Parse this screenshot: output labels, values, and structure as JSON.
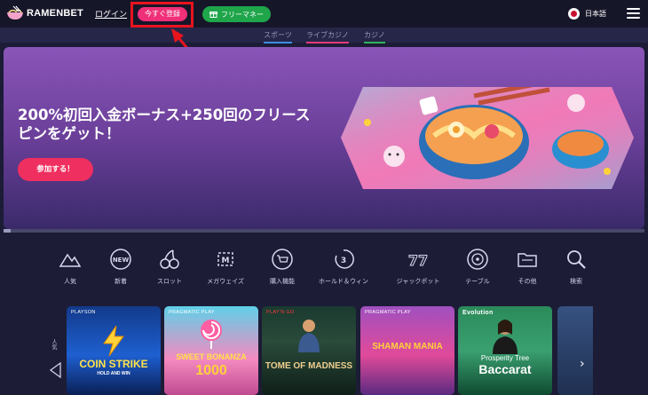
{
  "header": {
    "brand": "RAMENBET",
    "login_label": "ログイン",
    "register_label": "今すぐ登録",
    "freemoney_label": "フリーマネー",
    "language_label": "日本語"
  },
  "subnav": {
    "items": [
      {
        "label": "スポーツ",
        "color": "#3a8ee6"
      },
      {
        "label": "ライブカジノ",
        "color": "#e63a7a"
      },
      {
        "label": "カジノ",
        "color": "#2fb35a"
      }
    ]
  },
  "banner": {
    "title": "200%初回入金ボーナス+250回のフリースピンをゲット！",
    "cta_label": "参加する！"
  },
  "categories": [
    {
      "label": "人気",
      "icon": "mountain-icon"
    },
    {
      "label": "新着",
      "icon": "new-badge-icon"
    },
    {
      "label": "スロット",
      "icon": "cherries-icon"
    },
    {
      "label": "メガウェイズ",
      "icon": "megaways-icon"
    },
    {
      "label": "購入機能",
      "icon": "shopping-cart-icon"
    },
    {
      "label": "ホールド＆ウィン",
      "icon": "hold-and-win-icon"
    },
    {
      "label": "ジャックポット",
      "icon": "jackpot-777-icon"
    },
    {
      "label": "テーブル",
      "icon": "roulette-icon"
    },
    {
      "label": "その他",
      "icon": "folder-icon"
    },
    {
      "label": "検索",
      "icon": "search-icon"
    }
  ],
  "games_section": {
    "side_label": "人気"
  },
  "games": [
    {
      "provider": "PLAYSON",
      "title": "COIN STRIKE",
      "subtitle": "HOLD AND WIN"
    },
    {
      "provider": "PRAGMATIC PLAY",
      "title": "SWEET BONANZA",
      "subtitle": "1000"
    },
    {
      "provider": "PLAY'N GO",
      "title": "TOME OF MADNESS",
      "subtitle": ""
    },
    {
      "provider": "PRAGMATIC PLAY",
      "title": "SHAMAN MANIA",
      "subtitle": ""
    },
    {
      "provider": "Evolution",
      "title": "Prosperity Tree",
      "subtitle": "Baccarat"
    }
  ],
  "colors": {
    "register": "#ef2f78",
    "freemoney": "#1fa54a",
    "highlight": "#e8141e",
    "banner_cta": "#ef2f5f"
  }
}
